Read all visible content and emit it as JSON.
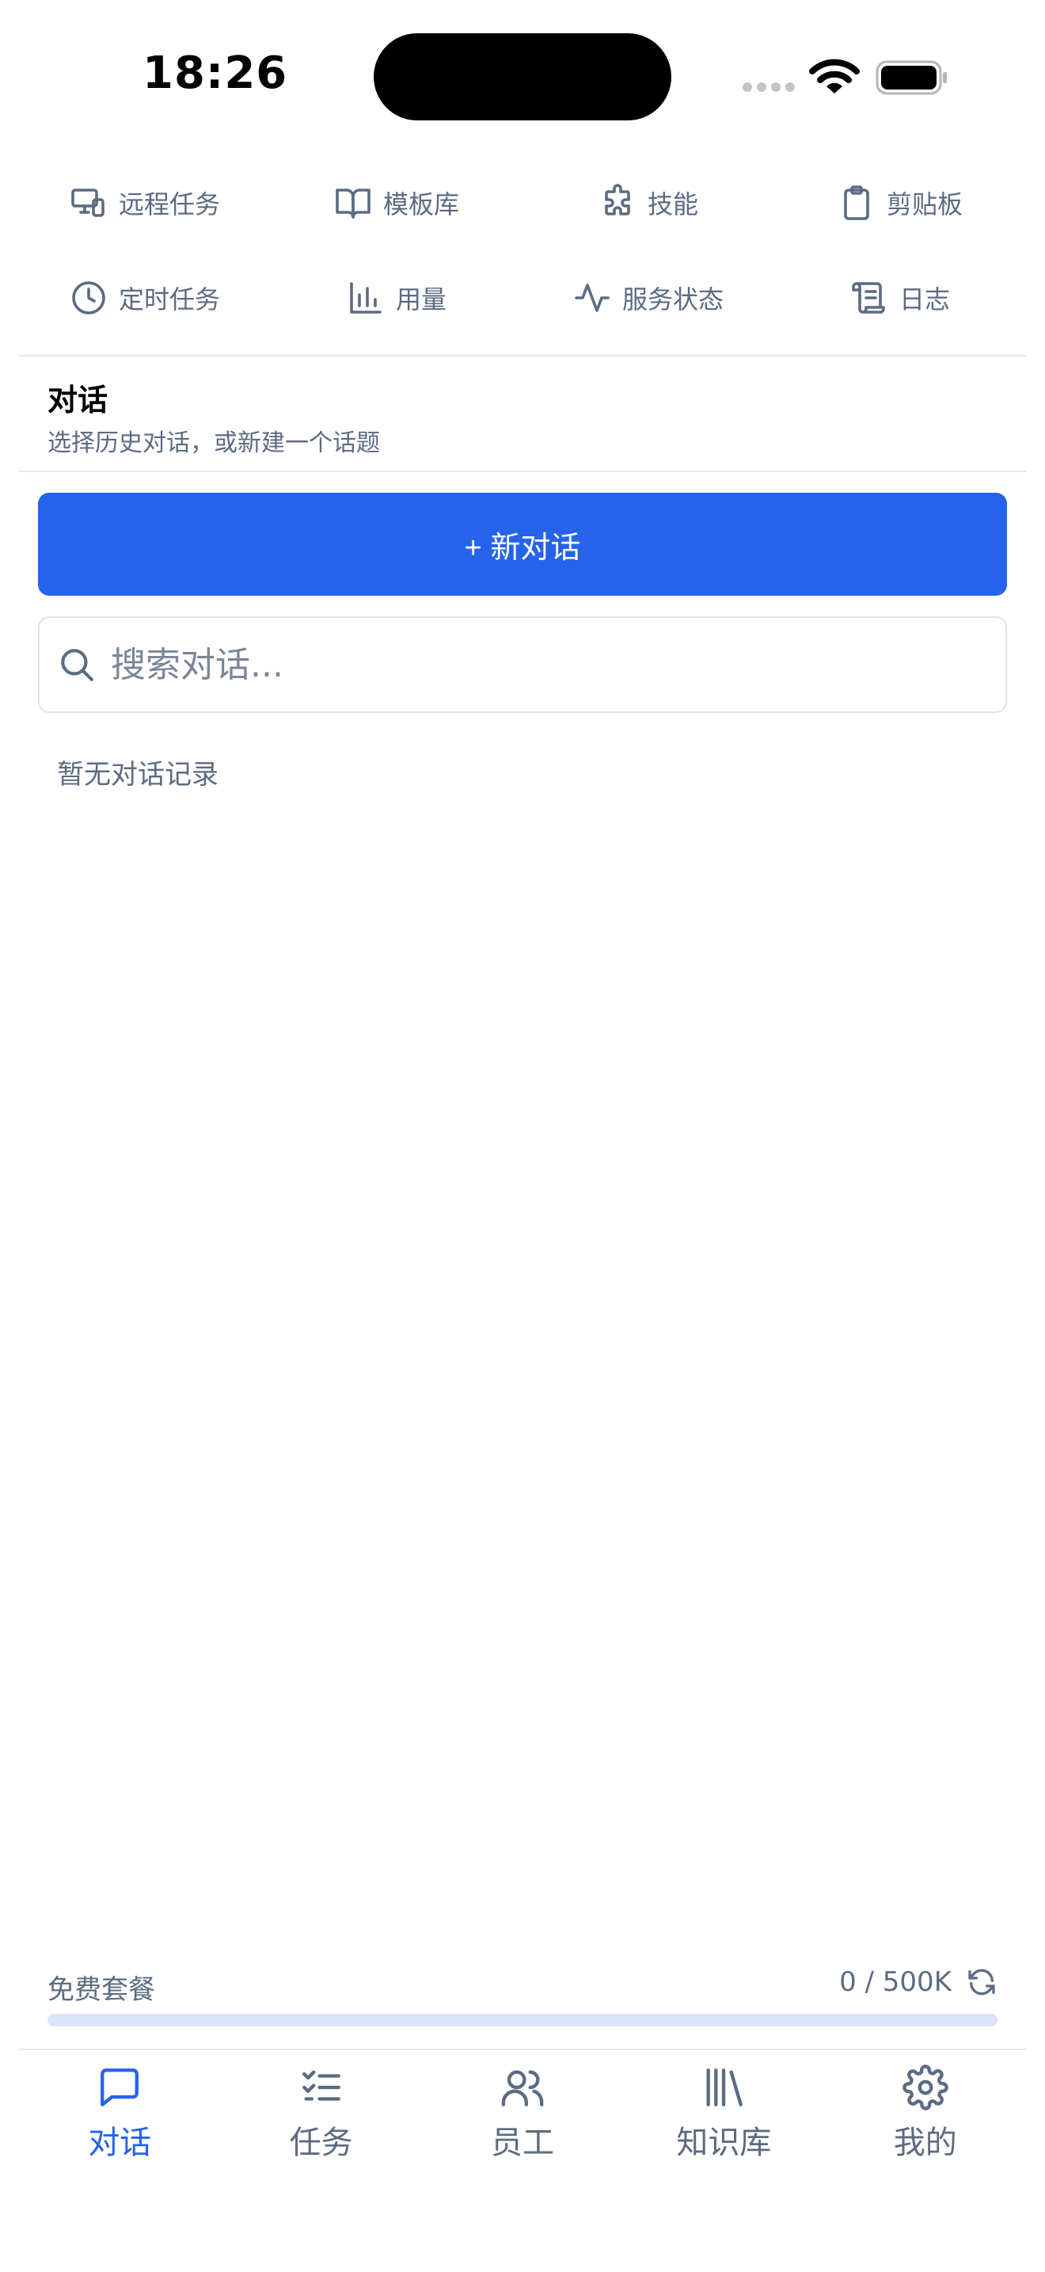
{
  "status_bar": {
    "time": "18:26"
  },
  "quick_actions": [
    {
      "label": "远程任务",
      "icon": "devices-icon"
    },
    {
      "label": "模板库",
      "icon": "book-open-icon"
    },
    {
      "label": "技能",
      "icon": "puzzle-icon"
    },
    {
      "label": "剪贴板",
      "icon": "clipboard-icon"
    },
    {
      "label": "定时任务",
      "icon": "clock-icon"
    },
    {
      "label": "用量",
      "icon": "bar-chart-icon"
    },
    {
      "label": "服务状态",
      "icon": "activity-icon"
    },
    {
      "label": "日志",
      "icon": "scroll-icon"
    }
  ],
  "section": {
    "title": "对话",
    "subtitle": "选择历史对话，或新建一个话题"
  },
  "new_chat_label": "+ 新对话",
  "search": {
    "placeholder": "搜索对话...",
    "value": ""
  },
  "empty_state": "暂无对话记录",
  "plan": {
    "name": "免费套餐",
    "usage_text": "0 / 500K",
    "used_fraction": 0
  },
  "tabs": [
    {
      "label": "对话",
      "icon": "chat-bubble-icon",
      "active": true
    },
    {
      "label": "任务",
      "icon": "task-list-icon",
      "active": false
    },
    {
      "label": "员工",
      "icon": "users-icon",
      "active": false
    },
    {
      "label": "知识库",
      "icon": "library-icon",
      "active": false
    },
    {
      "label": "我的",
      "icon": "gear-icon",
      "active": false
    }
  ],
  "colors": {
    "accent": "#2563eb",
    "muted_text": "#5b6b82",
    "divider": "#e3e7ed",
    "progress_track": "#dbe4fb"
  }
}
